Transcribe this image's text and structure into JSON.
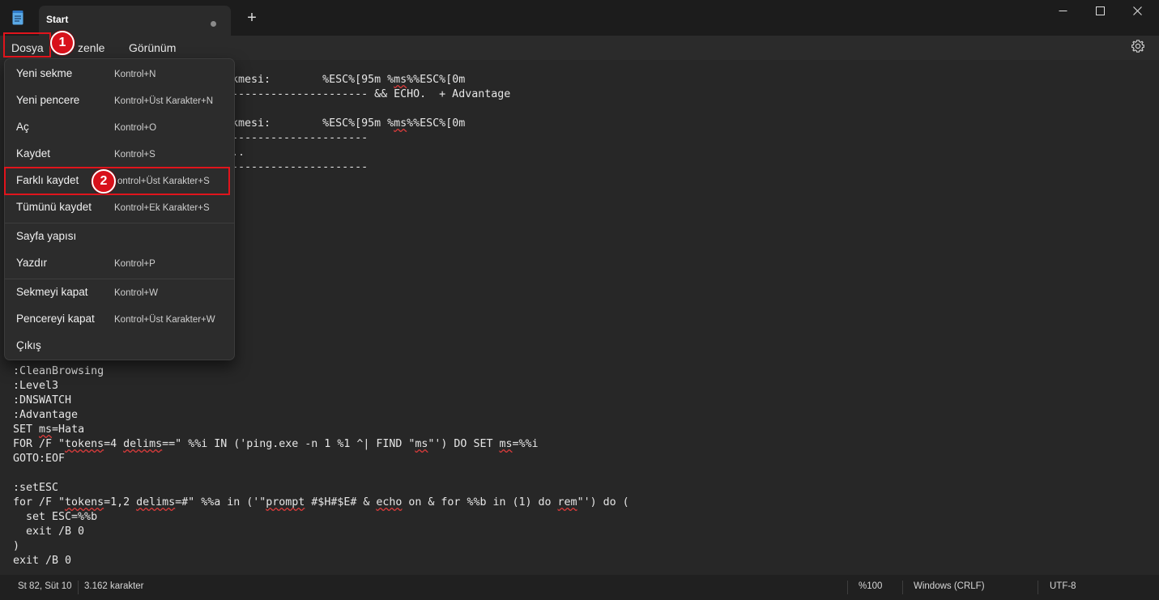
{
  "tab": {
    "title": "Start"
  },
  "menubar": {
    "file": "Dosya",
    "edit_partial": "zenle",
    "view": "Görünüm"
  },
  "file_menu": [
    {
      "label": "Yeni sekme",
      "shortcut": "Kontrol+N"
    },
    {
      "label": "Yeni pencere",
      "shortcut": "Kontrol+Üst Karakter+N"
    },
    {
      "label": "Aç",
      "shortcut": "Kontrol+O"
    },
    {
      "label": "Kaydet",
      "shortcut": "Kontrol+S"
    },
    {
      "label": "Farklı kaydet",
      "shortcut": "ontrol+Üst Karakter+S"
    },
    {
      "label": "Tümünü kaydet",
      "shortcut": "Kontrol+Ek Karakter+S"
    },
    {
      "label": "Sayfa yapısı",
      "shortcut": ""
    },
    {
      "label": "Yazdır",
      "shortcut": "Kontrol+P"
    },
    {
      "label": "Sekmeyi kapat",
      "shortcut": "Kontrol+W"
    },
    {
      "label": "Pencereyi kapat",
      "shortcut": "Kontrol+Üst Karakter+W"
    },
    {
      "label": "Çıkış",
      "shortcut": ""
    }
  ],
  "badges": {
    "step1": "1",
    "step2": "2"
  },
  "editor": {
    "visible_fragments": [
      "kmesi:        %ESC%[95m %ms%%ESC%[0m",
      "--------------------- && ECHO.  + Advantage",
      "kmesi:        %ESC%[95m %ms%%ESC%[0m",
      "---------------------",
      "..",
      "---------------------"
    ],
    "lines": [
      ":CleanBrowsing",
      ":Level3",
      ":DNSWATCH",
      ":Advantage",
      "SET ms=Hata",
      "FOR /F \"tokens=4 delims==\" %%i IN ('ping.exe -n 1 %1 ^| FIND \"ms\"') DO SET ms=%%i",
      "GOTO:EOF",
      "",
      ":setESC",
      "for /F \"tokens=1,2 delims=#\" %%a in ('\"prompt #$H#$E# & echo on & for %%b in (1) do rem\"') do (",
      "  set ESC=%%b",
      "  exit /B 0",
      ")",
      "exit /B 0"
    ]
  },
  "status": {
    "position": "St 82, Süt 10",
    "chars": "3.162 karakter",
    "zoom": "%100",
    "line_ending": "Windows (CRLF)",
    "encoding": "UTF-8"
  },
  "colors": {
    "highlight": "#e0141c",
    "badge": "#d8111b",
    "background": "#202020"
  }
}
